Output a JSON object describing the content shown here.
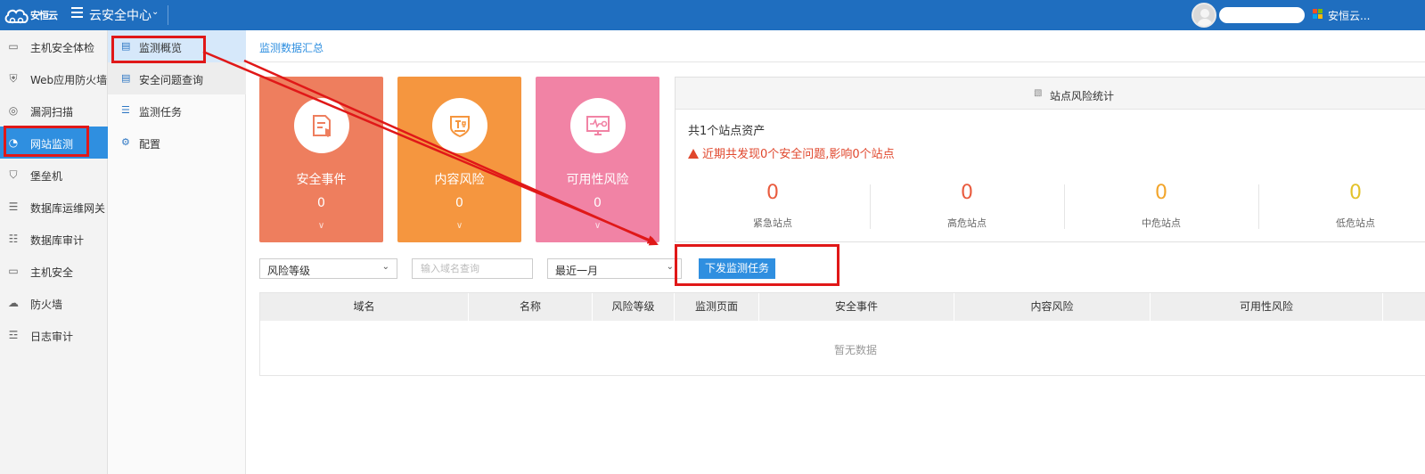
{
  "header": {
    "logo_text": "安恒云",
    "app_title": "云安全中心",
    "brand_name": "安恒云...",
    "colors": {
      "topbar": "#1f6ebf",
      "accent": "#2f8fe0"
    }
  },
  "sidebar": {
    "items": [
      {
        "label": "主机安全体检",
        "icon": "checkup-icon"
      },
      {
        "label": "Web应用防火墙",
        "icon": "waf-icon"
      },
      {
        "label": "漏洞扫描",
        "icon": "scan-icon"
      },
      {
        "label": "网站监测",
        "icon": "gauge-icon",
        "active": true
      },
      {
        "label": "堡垒机",
        "icon": "shield-icon"
      },
      {
        "label": "数据库运维网关",
        "icon": "database-icon"
      },
      {
        "label": "数据库审计",
        "icon": "database-audit-icon"
      },
      {
        "label": "主机安全",
        "icon": "monitor-icon"
      },
      {
        "label": "防火墙",
        "icon": "firewall-icon"
      },
      {
        "label": "日志审计",
        "icon": "log-icon"
      }
    ]
  },
  "subnav": {
    "items": [
      {
        "label": "监测概览",
        "icon": "overview-icon",
        "active": true
      },
      {
        "label": "安全问题查询",
        "icon": "list-icon"
      },
      {
        "label": "监测任务",
        "icon": "task-icon"
      },
      {
        "label": "配置",
        "icon": "gear-icon"
      }
    ]
  },
  "breadcrumb": {
    "label": "监测数据汇总"
  },
  "cards": [
    {
      "title": "安全事件",
      "count": "0",
      "more": "∨",
      "color": "#ee7e5e",
      "icon": "security-event-icon"
    },
    {
      "title": "内容风险",
      "count": "0",
      "more": "∨",
      "color": "#f5963f",
      "icon": "content-risk-icon"
    },
    {
      "title": "可用性风险",
      "count": "0",
      "more": "∨",
      "color": "#f183a5",
      "icon": "availability-icon"
    }
  ],
  "site_stats": {
    "title": "站点风险统计",
    "total": "共1个站点资产",
    "warning": "近期共发现0个安全问题,影响0个站点",
    "levels": [
      {
        "value": "0",
        "label": "紧急站点",
        "color": "#e95b3e"
      },
      {
        "value": "0",
        "label": "高危站点",
        "color": "#e95b3e"
      },
      {
        "value": "0",
        "label": "中危站点",
        "color": "#f2a52b"
      },
      {
        "value": "0",
        "label": "低危站点",
        "color": "#e3c22a"
      }
    ]
  },
  "filters": {
    "risk_level": "风险等级",
    "domain_placeholder": "输入域名查询",
    "period": "最近一月",
    "dispatch_button": "下发监测任务"
  },
  "table": {
    "columns": [
      "域名",
      "名称",
      "风险等级",
      "监测页面",
      "安全事件",
      "内容风险",
      "可用性风险"
    ],
    "empty": "暂无数据"
  }
}
